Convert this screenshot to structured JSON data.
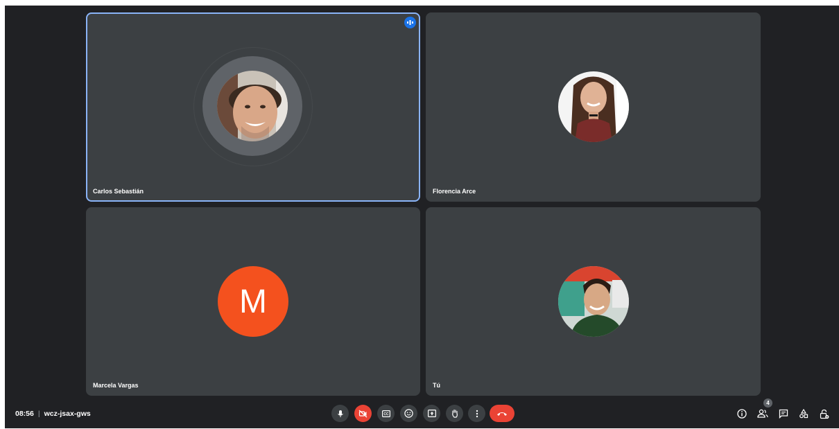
{
  "meeting": {
    "time": "08:56",
    "separator": "|",
    "code": "wcz-jsax-gws"
  },
  "participants": [
    {
      "name": "Carlos Sebastián",
      "speaking": true,
      "avatar": "photo"
    },
    {
      "name": "Florencia Arce",
      "speaking": false,
      "avatar": "photo"
    },
    {
      "name": "Marcela Vargas",
      "speaking": false,
      "avatar": "letter",
      "initial": "M",
      "color": "#f4511e"
    },
    {
      "name": "Tú",
      "speaking": false,
      "avatar": "photo"
    }
  ],
  "controls": [
    {
      "icon": "microphone-icon",
      "state": "on"
    },
    {
      "icon": "camera-off-icon",
      "state": "off",
      "color": "#ea4335"
    },
    {
      "icon": "captions-icon"
    },
    {
      "icon": "emoji-reaction-icon"
    },
    {
      "icon": "present-screen-icon"
    },
    {
      "icon": "raise-hand-icon"
    },
    {
      "icon": "more-options-icon"
    },
    {
      "icon": "hang-up-icon",
      "color": "#ea4335"
    }
  ],
  "right_controls": {
    "participant_count": "4",
    "icons": [
      "info-icon",
      "people-icon",
      "chat-icon",
      "activities-icon",
      "host-controls-icon"
    ]
  },
  "colors": {
    "background": "#202124",
    "tile": "#3c4043",
    "speaking_outline": "#8ab4f8",
    "speaking_badge": "#1a73e8"
  }
}
